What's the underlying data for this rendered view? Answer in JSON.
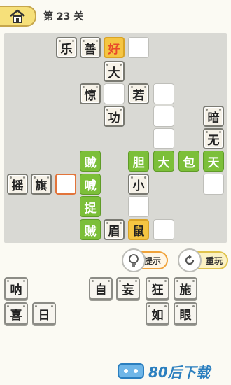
{
  "header": {
    "level_title": "第 23 关"
  },
  "board_cells": [
    {
      "text": "乐",
      "style": "fixed",
      "pos": "r0c2"
    },
    {
      "text": "善",
      "style": "fixed",
      "pos": "r0c3"
    },
    {
      "text": "好",
      "style": "yellow",
      "pos": "r0c4"
    },
    {
      "text": "",
      "style": "empty",
      "pos": "r0c5"
    },
    {
      "text": "大",
      "style": "fixed",
      "pos": "r1c4"
    },
    {
      "text": "惊",
      "style": "fixed",
      "pos": "r2c3"
    },
    {
      "text": "",
      "style": "empty",
      "pos": "r2c4"
    },
    {
      "text": "若",
      "style": "fixed",
      "pos": "r2c5"
    },
    {
      "text": "",
      "style": "empty",
      "pos": "r2c6"
    },
    {
      "text": "功",
      "style": "fixed",
      "pos": "r3c4"
    },
    {
      "text": "",
      "style": "empty",
      "pos": "r3c6"
    },
    {
      "text": "暗",
      "style": "fixed",
      "pos": "r3c8"
    },
    {
      "text": "",
      "style": "empty",
      "pos": "r4c6"
    },
    {
      "text": "无",
      "style": "fixed",
      "pos": "r4c8"
    },
    {
      "text": "贼",
      "style": "green",
      "pos": "r5c3"
    },
    {
      "text": "胆",
      "style": "green",
      "pos": "r5c5"
    },
    {
      "text": "大",
      "style": "green",
      "pos": "r5c6"
    },
    {
      "text": "包",
      "style": "green",
      "pos": "r5c7"
    },
    {
      "text": "天",
      "style": "green",
      "pos": "r5c8"
    },
    {
      "text": "摇",
      "style": "fixed",
      "pos": "r6c0"
    },
    {
      "text": "旗",
      "style": "fixed",
      "pos": "r6c1"
    },
    {
      "text": "",
      "style": "sel",
      "pos": "r6c2"
    },
    {
      "text": "喊",
      "style": "green",
      "pos": "r6c3"
    },
    {
      "text": "小",
      "style": "fixed",
      "pos": "r6c5"
    },
    {
      "text": "",
      "style": "empty",
      "pos": "r6c8"
    },
    {
      "text": "捉",
      "style": "green",
      "pos": "r7c3"
    },
    {
      "text": "",
      "style": "empty",
      "pos": "r7c5"
    },
    {
      "text": "贼",
      "style": "green",
      "pos": "r8c3"
    },
    {
      "text": "眉",
      "style": "fixed",
      "pos": "r8c4"
    },
    {
      "text": "鼠",
      "style": "yellow2",
      "pos": "r8c5"
    },
    {
      "text": "",
      "style": "empty",
      "pos": "r8c6"
    }
  ],
  "buttons": {
    "hint_label": "提示",
    "reset_label": "重玩"
  },
  "answer_tiles": [
    "呐",
    "自",
    "妄",
    "狂",
    "施",
    "喜",
    "日",
    "如",
    "眼"
  ],
  "footer": {
    "brand": "80后下载"
  },
  "icons": [
    "home-icon",
    "lightbulb-icon",
    "refresh-icon",
    "logo-icon"
  ]
}
